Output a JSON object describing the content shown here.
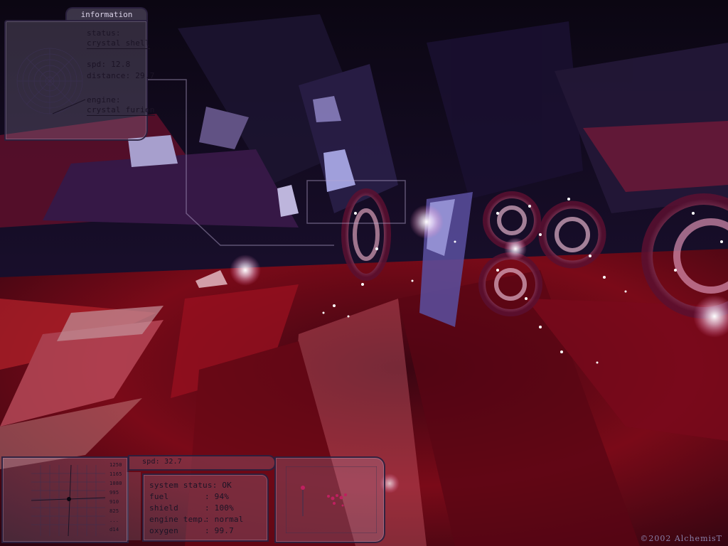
{
  "hud": {
    "info": {
      "title": "information",
      "status_label": "status:",
      "status_value": "crystal shell",
      "spd": "spd: 12.8",
      "distance": "distance: 29.7",
      "engine_label": "engine:",
      "engine_value": "crystal furion"
    },
    "speed_strip": "spd: 32.7",
    "radar_ticks": [
      "1250",
      "1165",
      "1080",
      "995",
      "910",
      "825",
      "...",
      "d14"
    ],
    "system": {
      "title": "system status: OK",
      "rows": [
        {
          "label": "fuel",
          "value": ": 94%"
        },
        {
          "label": "shield",
          "value": ": 100%"
        },
        {
          "label": "engine temp.",
          "value": ": normal"
        },
        {
          "label": "oxygen",
          "value": ": 99.7"
        }
      ]
    }
  },
  "copyright": "©2002 AlchemisT",
  "colors": {
    "floor": "#8a0c1a",
    "sky": "#1a0f2e",
    "hud_tint": "#b4aac8",
    "glow": "#ffffff",
    "spiral": "#e6c8d8"
  }
}
